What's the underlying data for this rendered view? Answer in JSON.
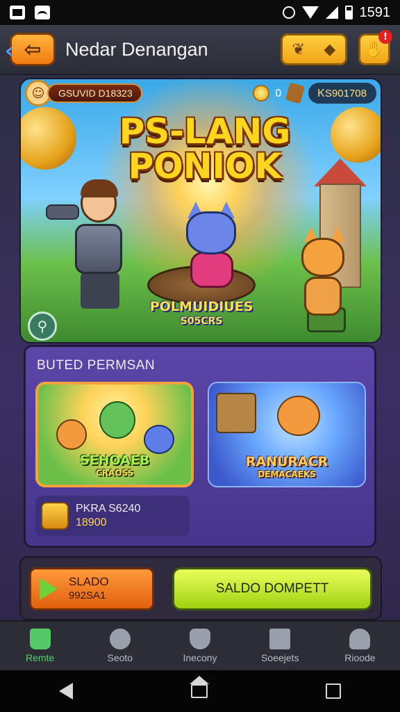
{
  "status_bar": {
    "time": "1591",
    "icons": [
      "notification-icon",
      "image-icon",
      "alarm-icon",
      "wifi-icon",
      "signal-icon",
      "battery-icon"
    ]
  },
  "header": {
    "back_icon": "arrow-left-icon",
    "title": "Nedar Denangan",
    "notification_badge": "!"
  },
  "banner": {
    "username": "GSUVID D18323",
    "coin_count": "0",
    "balance": "ᏦS901708",
    "game_title_line1": "PS-LANG",
    "game_title_line2": "PONIOK",
    "logo_line1": "POLMUIDIUES",
    "logo_line2": "S05CRS"
  },
  "features": {
    "title": "BUTED PERMSAN",
    "cards": [
      {
        "label": "SEHOAEB",
        "sub": "CRAOSS"
      },
      {
        "label": "RANURACR",
        "sub": "DEMACAEKS"
      }
    ],
    "prize": {
      "name": "PKRA S6240",
      "value": "18900"
    }
  },
  "actions": {
    "left_line1": "SLADO",
    "left_line2": "992SA1",
    "right_label": "SALDO DOMPETT"
  },
  "bottom_nav": {
    "items": [
      {
        "label": "Remte",
        "icon": "home-icon",
        "active": true
      },
      {
        "label": "Seoto",
        "icon": "face-icon",
        "active": false
      },
      {
        "label": "Inecony",
        "icon": "shield-icon",
        "active": false
      },
      {
        "label": "Soeejets",
        "icon": "map-icon",
        "active": false
      },
      {
        "label": "Rioode",
        "icon": "user-icon",
        "active": false
      }
    ]
  },
  "colors": {
    "accent_orange": "#f07c12",
    "accent_yellow": "#ffd61e",
    "panel_purple": "#5b46a8",
    "lime_button": "#c8ef30",
    "nav_active": "#57d16f"
  }
}
